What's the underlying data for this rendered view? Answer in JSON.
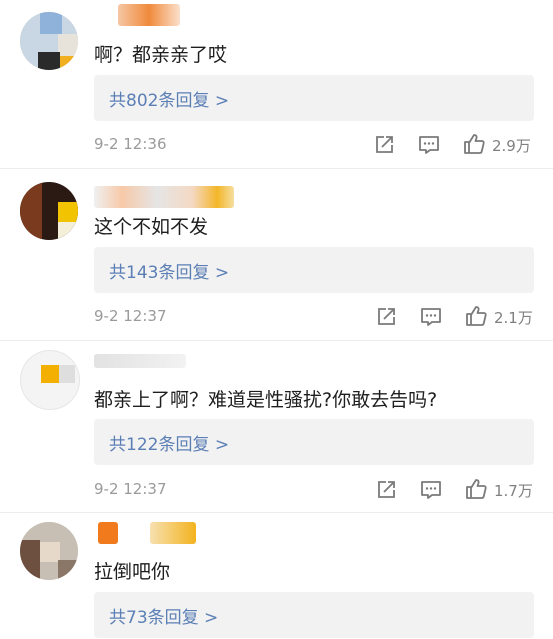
{
  "comments": [
    {
      "text": "啊？都亲亲了哎",
      "reply_label": "共802条回复 >",
      "time": "9-2 12:36",
      "likes": "2.9万"
    },
    {
      "text": "这个不如不发",
      "reply_label": "共143条回复 >",
      "time": "9-2 12:37",
      "likes": "2.1万"
    },
    {
      "text": "都亲上了啊？难道是性骚扰?你敢去告吗?",
      "reply_label": "共122条回复 >",
      "time": "9-2 12:37",
      "likes": "1.7万"
    },
    {
      "text": "拉倒吧你",
      "reply_label": "共73条回复 >"
    }
  ],
  "icons": {
    "share": "share-icon",
    "comment": "comment-icon",
    "like": "like-icon"
  },
  "colors": {
    "reply_link": "#5b7fb5",
    "reply_bg": "#f2f2f2",
    "meta_text": "#9a9a9a",
    "icon": "#7a7a7a"
  }
}
